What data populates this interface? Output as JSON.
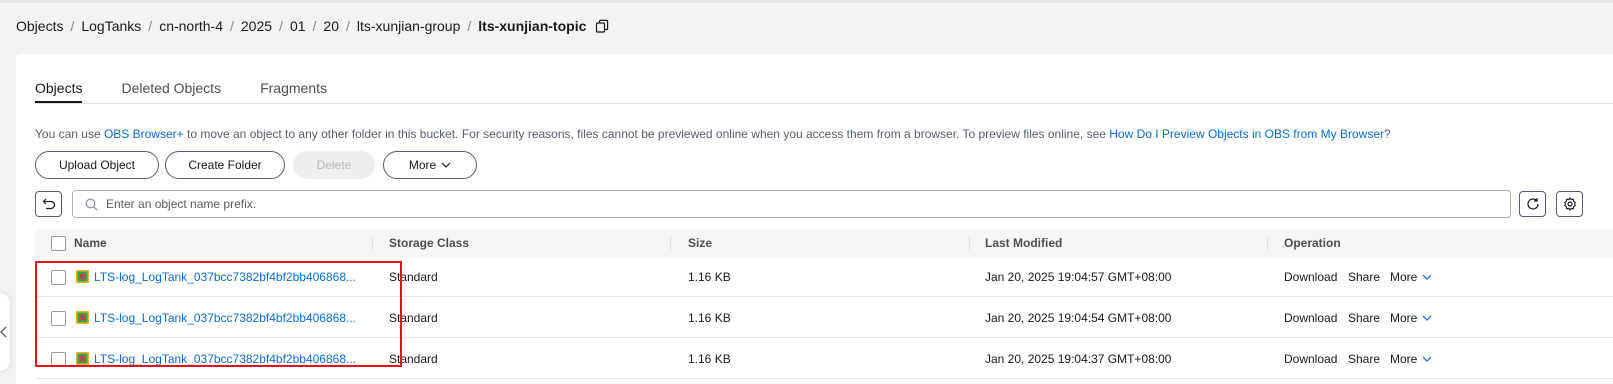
{
  "breadcrumb": {
    "items": [
      "Objects",
      "LogTanks",
      "cn-north-4",
      "2025",
      "01",
      "20",
      "lts-xunjian-group"
    ],
    "current": "lts-xunjian-topic",
    "separator": "/"
  },
  "tabs": [
    "Objects",
    "Deleted Objects",
    "Fragments"
  ],
  "notice": {
    "prefix": "You can use ",
    "link1": "OBS Browser+",
    "middle": " to move an object to any other folder in this bucket. For security reasons, files cannot be previewed online when you access them from a browser. To preview files online, see ",
    "link2": "How Do I Preview Objects in OBS from My Browser",
    "suffix": "?"
  },
  "toolbar": {
    "upload": "Upload Object",
    "create_folder": "Create Folder",
    "delete": "Delete",
    "more": "More"
  },
  "search": {
    "placeholder": "Enter an object name prefix."
  },
  "table": {
    "headers": [
      "Name",
      "Storage Class",
      "Size",
      "Last Modified",
      "Operation"
    ],
    "rows": [
      {
        "name": "LTS-log_LogTank_037bcc7382bf4bf2bb406868...",
        "storage_class": "Standard",
        "size": "1.16 KB",
        "modified": "Jan 20, 2025 19:04:57 GMT+08:00"
      },
      {
        "name": "LTS-log_LogTank_037bcc7382bf4bf2bb406868...",
        "storage_class": "Standard",
        "size": "1.16 KB",
        "modified": "Jan 20, 2025 19:04:54 GMT+08:00"
      },
      {
        "name": "LTS-log_LogTank_037bcc7382bf4bf2bb406868...",
        "storage_class": "Standard",
        "size": "1.16 KB",
        "modified": "Jan 20, 2025 19:04:37 GMT+08:00"
      }
    ],
    "operations": {
      "download": "Download",
      "share": "Share",
      "more": "More"
    }
  },
  "colors": {
    "link": "#0a6dd8",
    "highlight_box": "#e0151b",
    "text": "#191919"
  },
  "icons": [
    "copy-icon",
    "chevron-down-icon",
    "back-icon",
    "search-icon",
    "refresh-icon",
    "settings-icon",
    "file-icon",
    "chevron-left-icon"
  ]
}
